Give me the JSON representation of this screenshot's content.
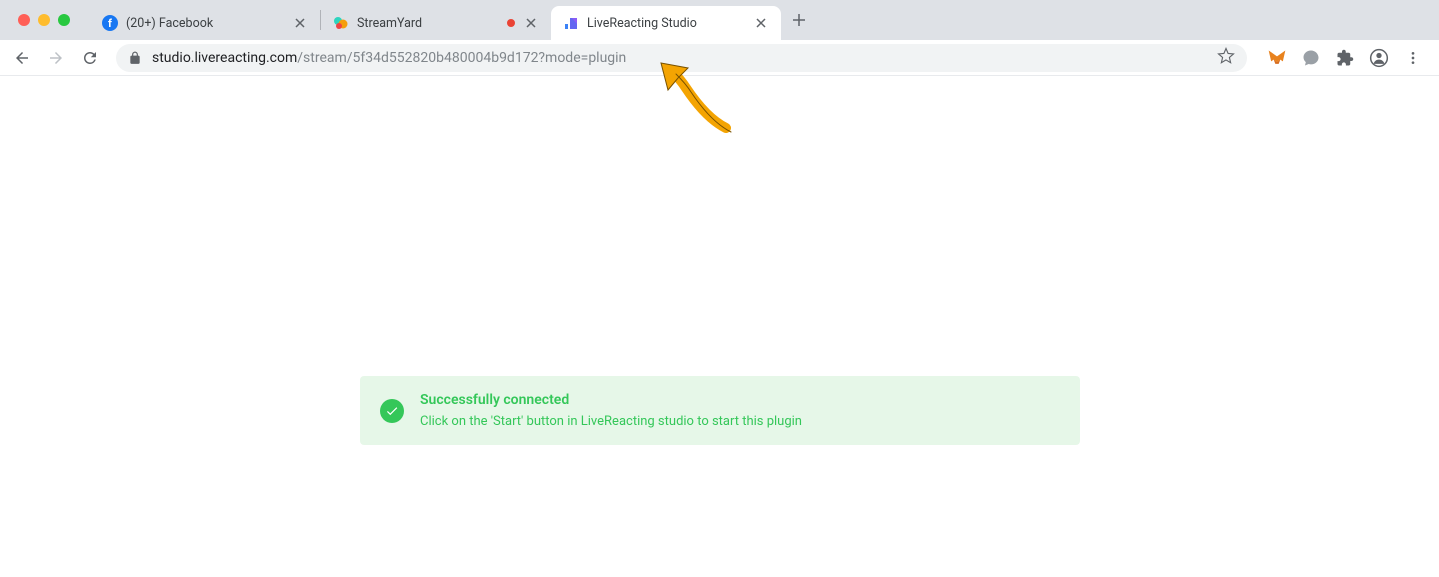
{
  "tabs": [
    {
      "title": "(20+) Facebook",
      "active": false
    },
    {
      "title": "StreamYard",
      "active": false,
      "recording": true
    },
    {
      "title": "LiveReacting Studio",
      "active": true
    }
  ],
  "url": {
    "domain": "studio.livereacting.com",
    "path": "/stream/5f34d552820b480004b9d172?mode=plugin"
  },
  "alert": {
    "title": "Successfully connected",
    "description": "Click on the 'Start' button in LiveReacting studio to start this plugin"
  }
}
